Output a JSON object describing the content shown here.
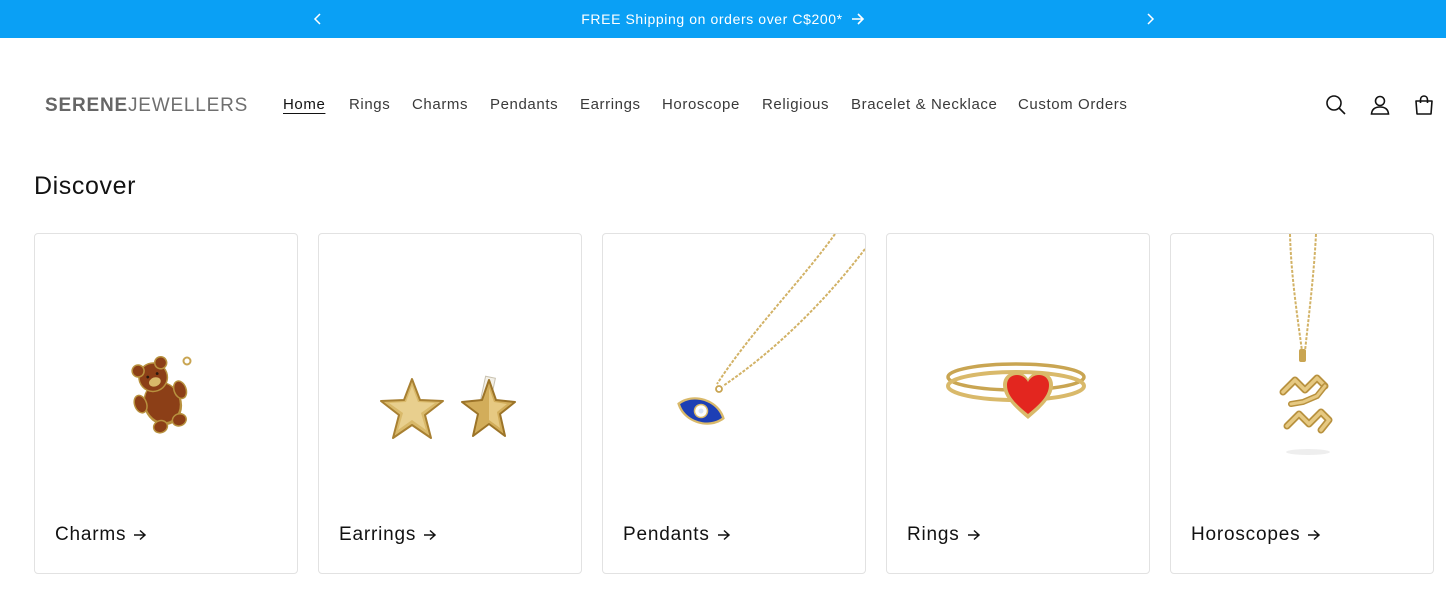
{
  "announcement": {
    "text": "FREE Shipping on orders over C$200*",
    "background": "#0aa0f5",
    "prev_icon": "chevron-left-icon",
    "next_icon": "chevron-right-icon",
    "link_icon": "arrow-right-icon"
  },
  "header": {
    "logo_bold": "SERENE",
    "logo_light": "JEWELLERS",
    "nav": [
      {
        "label": "Home",
        "active": true
      },
      {
        "label": "Rings",
        "active": false
      },
      {
        "label": "Charms",
        "active": false
      },
      {
        "label": "Pendants",
        "active": false
      },
      {
        "label": "Earrings",
        "active": false
      },
      {
        "label": "Horoscope",
        "active": false
      },
      {
        "label": "Religious",
        "active": false
      },
      {
        "label": "Bracelet & Necklace",
        "active": false
      },
      {
        "label": "Custom Orders",
        "active": false
      }
    ],
    "icons": [
      "search-icon",
      "account-icon",
      "cart-icon"
    ]
  },
  "discover": {
    "heading": "Discover",
    "collections": [
      {
        "label": "Charms",
        "image": "teddy-bear-charm"
      },
      {
        "label": "Earrings",
        "image": "star-stud-earrings"
      },
      {
        "label": "Pendants",
        "image": "evil-eye-pendant"
      },
      {
        "label": "Rings",
        "image": "heart-ring"
      },
      {
        "label": "Horoscopes",
        "image": "aquarius-pendant"
      }
    ]
  },
  "colors": {
    "accent": "#0aa0f5",
    "gold": "#d9b96a",
    "gold_dark": "#b8913e",
    "text": "#121212"
  }
}
